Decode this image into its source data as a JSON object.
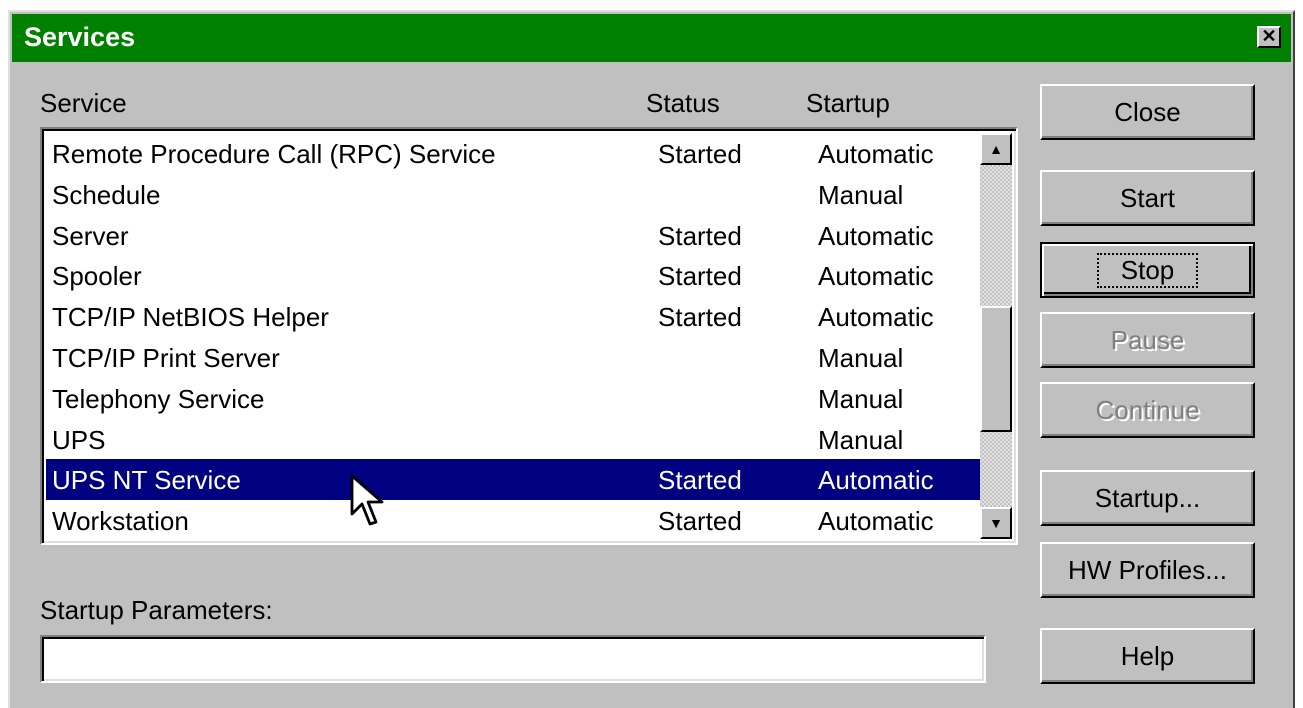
{
  "window": {
    "title": "Services",
    "close_glyph": "✕"
  },
  "columns": {
    "service": "Service",
    "status": "Status",
    "startup": "Startup"
  },
  "services": [
    {
      "name": "Remote Procedure Call (RPC) Service",
      "status": "Started",
      "startup": "Automatic",
      "selected": false
    },
    {
      "name": "Schedule",
      "status": "",
      "startup": "Manual",
      "selected": false
    },
    {
      "name": "Server",
      "status": "Started",
      "startup": "Automatic",
      "selected": false
    },
    {
      "name": "Spooler",
      "status": "Started",
      "startup": "Automatic",
      "selected": false
    },
    {
      "name": "TCP/IP NetBIOS Helper",
      "status": "Started",
      "startup": "Automatic",
      "selected": false
    },
    {
      "name": "TCP/IP Print Server",
      "status": "",
      "startup": "Manual",
      "selected": false
    },
    {
      "name": "Telephony Service",
      "status": "",
      "startup": "Manual",
      "selected": false
    },
    {
      "name": "UPS",
      "status": "",
      "startup": "Manual",
      "selected": false
    },
    {
      "name": "UPS NT Service",
      "status": "Started",
      "startup": "Automatic",
      "selected": true
    },
    {
      "name": "Workstation",
      "status": "Started",
      "startup": "Automatic",
      "selected": false
    }
  ],
  "scroll": {
    "up_glyph": "▲",
    "down_glyph": "▼",
    "position": 0.64
  },
  "startup_parameters": {
    "label": "Startup Parameters:",
    "value": ""
  },
  "buttons": {
    "close": "Close",
    "start": "Start",
    "stop": "Stop",
    "pause": "Pause",
    "continue": "Continue",
    "startup": "Startup...",
    "hw_profiles": "HW Profiles...",
    "help": "Help"
  },
  "colors": {
    "titlebar": "#008000",
    "selection": "#000080",
    "face": "#c0c0c0"
  }
}
